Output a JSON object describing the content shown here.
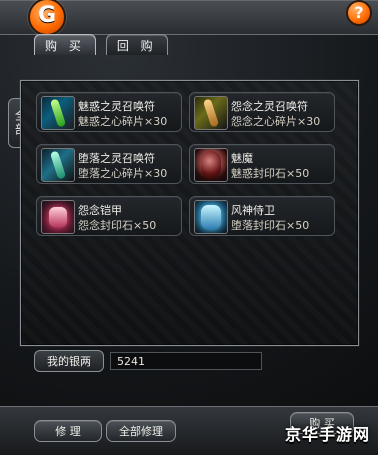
{
  "tabs": [
    {
      "label": "购 买"
    },
    {
      "label": "回 购"
    }
  ],
  "sidebar": {
    "label": "全部"
  },
  "items": [
    {
      "name": "魅惑之灵召唤符",
      "desc": "魅惑之心碎片×30",
      "icon": "scroll-icon"
    },
    {
      "name": "怨念之灵召唤符",
      "desc": "怨念之心碎片×30",
      "icon": "scroll-icon"
    },
    {
      "name": "堕落之灵召唤符",
      "desc": "堕落之心碎片×30",
      "icon": "scroll-icon"
    },
    {
      "name": "魅魔",
      "desc": "魅惑封印石×50",
      "icon": "portrait-icon"
    },
    {
      "name": "怨念铠甲",
      "desc": "怨念封印石×50",
      "icon": "armor-icon"
    },
    {
      "name": "风神侍卫",
      "desc": "堕落封印石×50",
      "icon": "guard-icon"
    }
  ],
  "money": {
    "label": "我的银两",
    "value": "5241"
  },
  "buttons": {
    "repair": "修 理",
    "repair_all": "全部修理",
    "buy": "购 买"
  },
  "watermark": "京华手游网"
}
